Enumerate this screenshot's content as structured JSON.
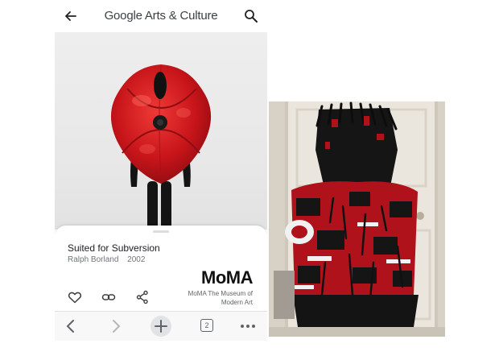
{
  "app": {
    "brand_google": "Google",
    "brand_rest": "Arts & Culture"
  },
  "artwork": {
    "title": "Suited for Subversion",
    "artist": "Ralph Borland",
    "year": "2002"
  },
  "museum": {
    "logo": "MoMA",
    "name": "MoMA The Museum of Modern Art"
  },
  "actions": [
    "heart-icon",
    "link-icon",
    "share-icon"
  ],
  "browser": {
    "tab_count": "2"
  },
  "colors": {
    "suit_red": "#c8151a",
    "fleece_red": "#b0121b",
    "accent_black": "#111111"
  }
}
